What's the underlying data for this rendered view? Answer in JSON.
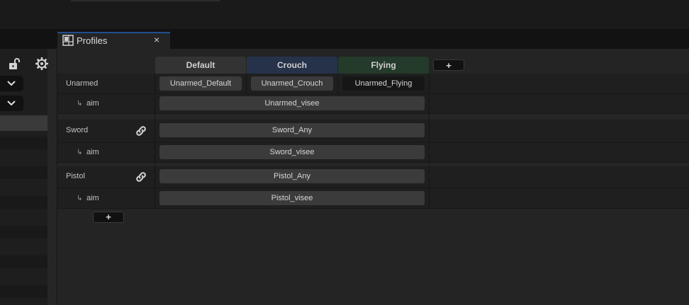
{
  "tab": {
    "title": "Profiles",
    "close": "×"
  },
  "columns": [
    {
      "label": "Default",
      "color": "#333333"
    },
    {
      "label": "Crouch",
      "color": "#25324a"
    },
    {
      "label": "Flying",
      "color": "#243a2a"
    }
  ],
  "add_column_label": "+",
  "add_row_label": "+",
  "rows": [
    {
      "label": "Unarmed",
      "linked": false,
      "cells": [
        "Unarmed_Default",
        "Unarmed_Crouch",
        "Unarmed_Flying"
      ]
    },
    {
      "label": "aim",
      "sub": true,
      "cells": [
        "Unarmed_visee"
      ]
    },
    {
      "label": "Sword",
      "linked": true,
      "cells": [
        "Sword_Any"
      ]
    },
    {
      "label": "aim",
      "sub": true,
      "cells": [
        "Sword_visee"
      ]
    },
    {
      "label": "Pistol",
      "linked": true,
      "cells": [
        "Pistol_Any"
      ]
    },
    {
      "label": "aim",
      "sub": true,
      "cells": [
        "Pistol_visee"
      ]
    }
  ],
  "sub_arrow": "↳",
  "icons": {
    "lock": "unlock-icon",
    "gear": "gear-icon",
    "link": "link-icon",
    "tab": "layout-icon"
  }
}
